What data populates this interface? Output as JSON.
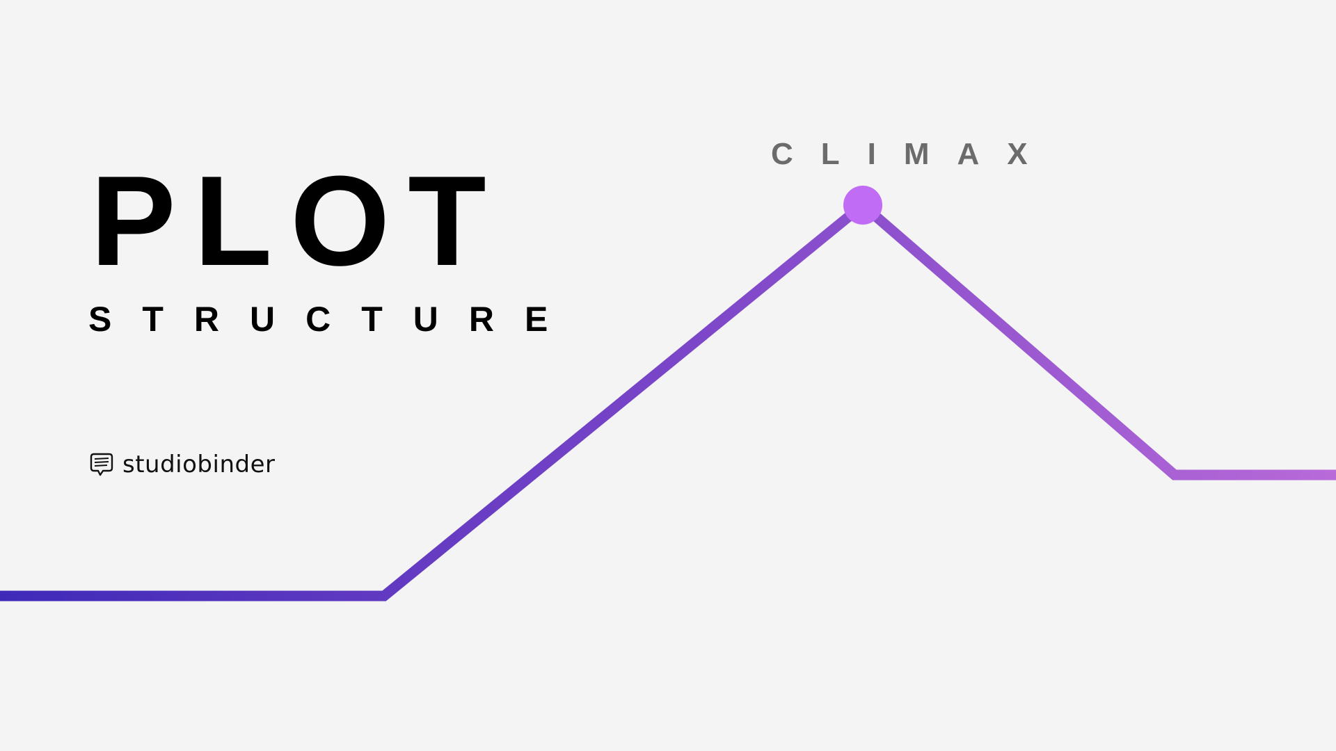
{
  "title": "PLOT",
  "subtitle": "STRUCTURE",
  "diagram": {
    "peak_label": "CLIMAX",
    "colors": {
      "line_start": "#3f2ab8",
      "line_mid": "#7a45c8",
      "line_end": "#b86ad8",
      "peak_dot": "#c06cf5",
      "peak_label": "#6b6b6b"
    }
  },
  "brand": {
    "name": "studiobinder",
    "icon": "speech-bubble-logo"
  },
  "colors": {
    "background": "#f4f4f5",
    "text": "#000000"
  }
}
